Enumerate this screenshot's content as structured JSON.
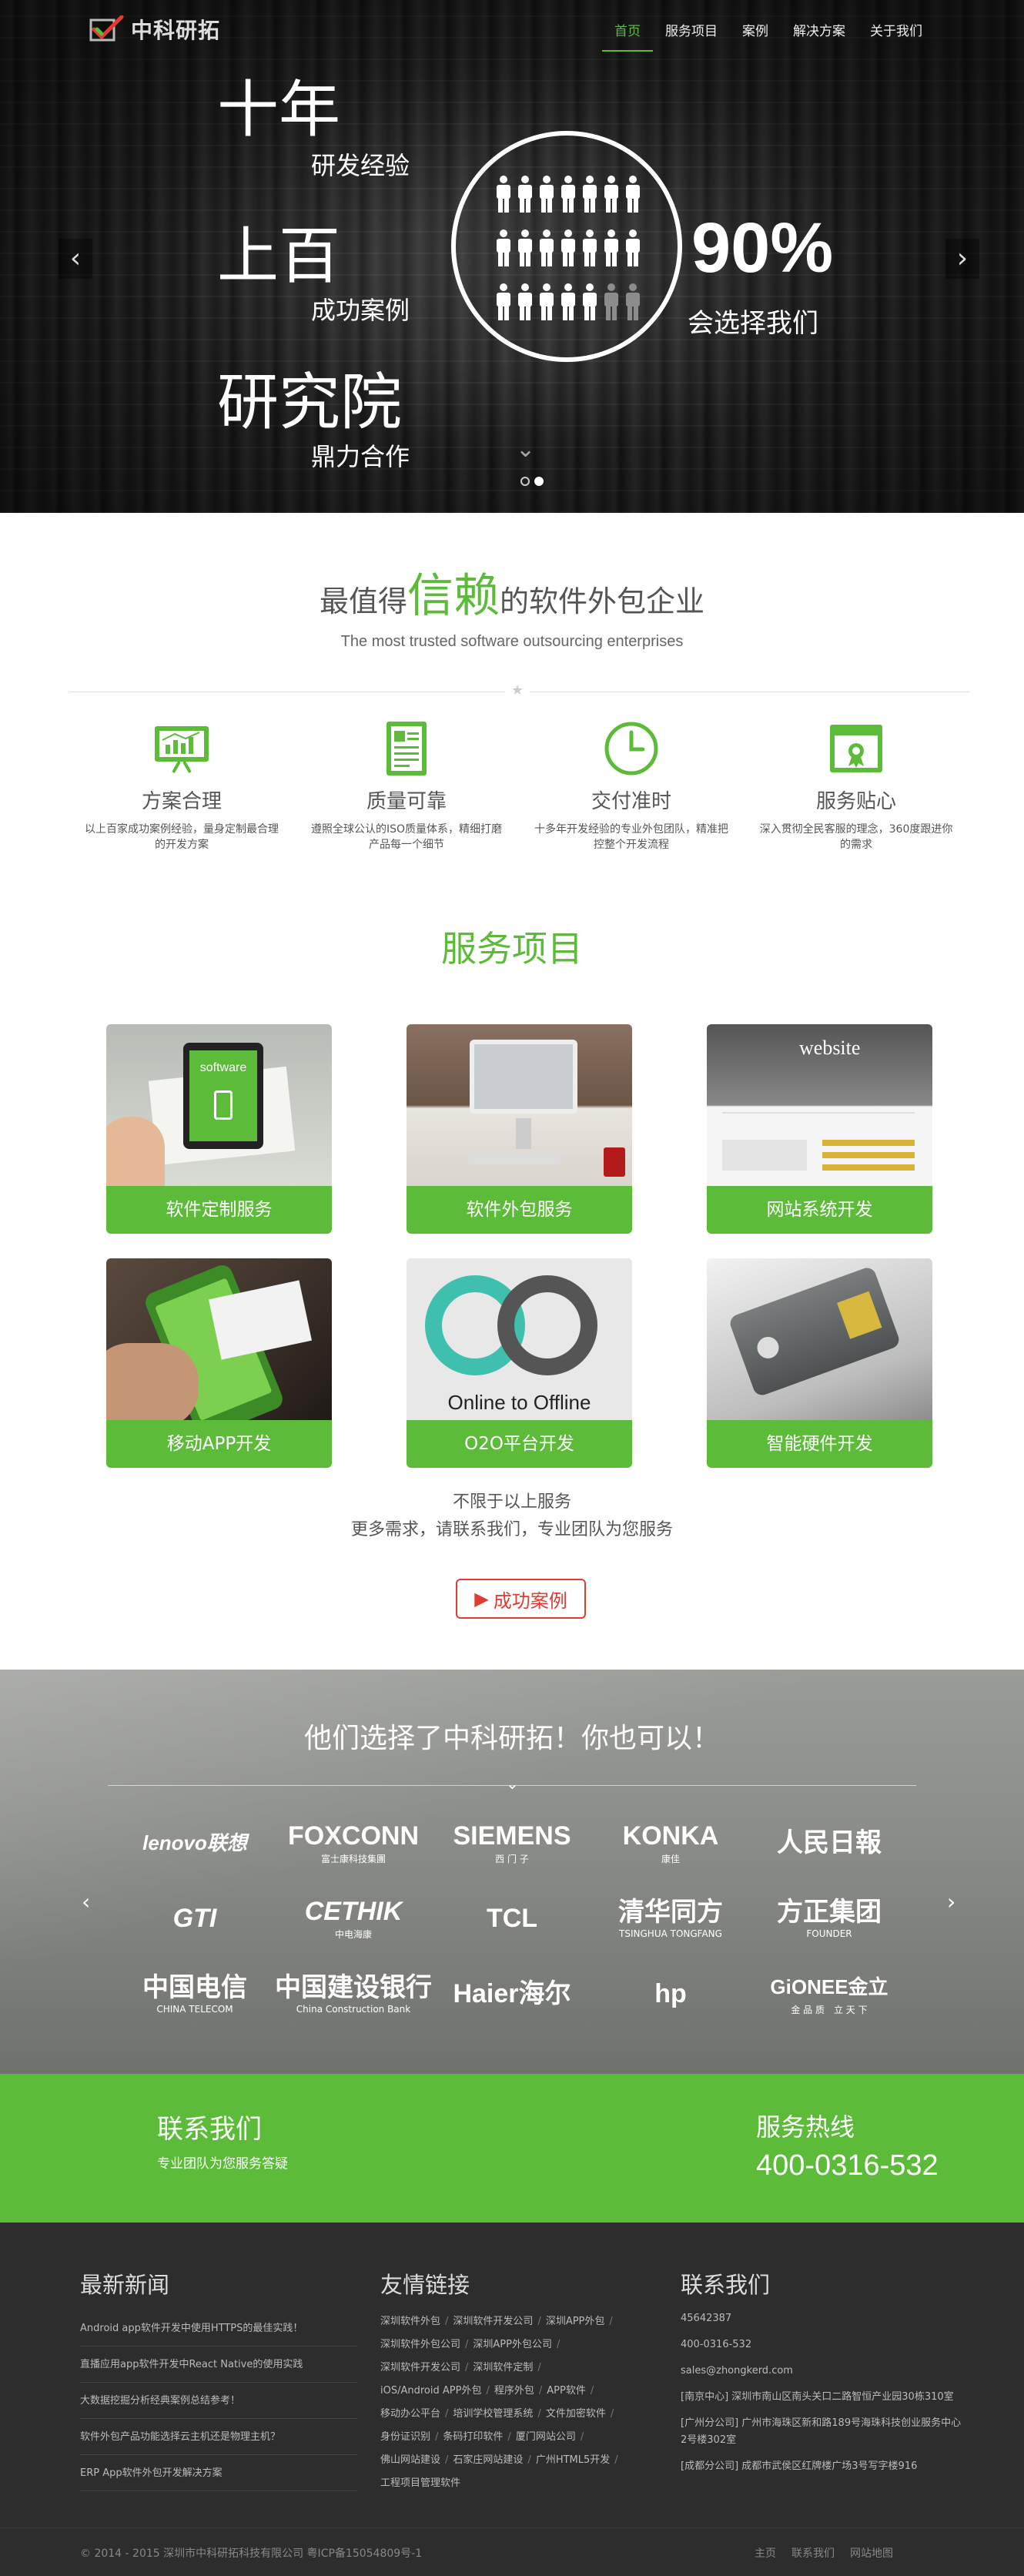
{
  "nav": {
    "logo_text": "中科研拓",
    "items": [
      {
        "label": "首页",
        "active": true
      },
      {
        "label": "服务项目",
        "active": false
      },
      {
        "label": "案例",
        "active": false
      },
      {
        "label": "解决方案",
        "active": false
      },
      {
        "label": "关于我们",
        "active": false
      }
    ]
  },
  "hero": {
    "line1_big": "十年",
    "line1_small": "研发经验",
    "line2_big": "上百",
    "line2_small": "成功案例",
    "line3_big": "研究院",
    "line3_small": "鼎力合作",
    "percent": "90%",
    "percent_caption": "会选择我们",
    "people_total": 21,
    "people_highlighted": 19,
    "prev_icon": "chevron-left-icon",
    "next_icon": "chevron-right-icon",
    "slides": 2,
    "active_slide": 2
  },
  "trust": {
    "title_pre": "最值得",
    "title_highlight": "信赖",
    "title_post": "的软件外包企业",
    "subtitle": "The most trusted software outsourcing enterprises"
  },
  "features": [
    {
      "icon": "chart-board-icon",
      "title": "方案合理",
      "desc": "以上百家成功案例经验，量身定制最合理的开发方案"
    },
    {
      "icon": "document-icon",
      "title": "质量可靠",
      "desc": "遵照全球公认的ISO质量体系，精细打磨产品每一个细节"
    },
    {
      "icon": "clock-icon",
      "title": "交付准时",
      "desc": "十多年开发经验的专业外包团队，精准把控整个开发流程"
    },
    {
      "icon": "certificate-icon",
      "title": "服务贴心",
      "desc": "深入贯彻全民客服的理念，360度跟进你的需求"
    }
  ],
  "services": {
    "title": "服务项目",
    "items": [
      {
        "label": "软件定制服务",
        "image_text": "software"
      },
      {
        "label": "软件外包服务",
        "image_text": ""
      },
      {
        "label": "网站系统开发",
        "image_text": "website"
      },
      {
        "label": "移动APP开发",
        "image_text": ""
      },
      {
        "label": "O2O平台开发",
        "image_text": "Online to Offline"
      },
      {
        "label": "智能硬件开发",
        "image_text": ""
      }
    ],
    "note_line1": "不限于以上服务",
    "note_line2": "更多需求，请联系我们，专业团队为您服务",
    "case_button": "成功案例"
  },
  "clients": {
    "title": "他们选择了中科研拓！你也可以！",
    "logos": [
      {
        "name": "lenovo联想",
        "sub": ""
      },
      {
        "name": "FOXCONN",
        "sub": "富士康科技集團"
      },
      {
        "name": "SIEMENS",
        "sub": "西 门 子"
      },
      {
        "name": "KONKA",
        "sub": "康佳"
      },
      {
        "name": "人民日報",
        "sub": ""
      },
      {
        "name": "GTI",
        "sub": ""
      },
      {
        "name": "CETHIK",
        "sub": "中电海康"
      },
      {
        "name": "TCL",
        "sub": ""
      },
      {
        "name": "清华同方",
        "sub": "TSINGHUA TONGFANG"
      },
      {
        "name": "方正集团",
        "sub": "FOUNDER"
      },
      {
        "name": "中国电信",
        "sub": "CHINA TELECOM"
      },
      {
        "name": "中国建设银行",
        "sub": "China Construction Bank"
      },
      {
        "name": "Haier海尔",
        "sub": ""
      },
      {
        "name": "hp",
        "sub": ""
      },
      {
        "name": "GiONEE金立",
        "sub": "金 品 质　立 天 下"
      }
    ]
  },
  "contact": {
    "title": "联系我们",
    "subtitle": "专业团队为您服务答疑",
    "hotline_title": "服务热线",
    "hotline": "400-0316-532"
  },
  "footer": {
    "news_title": "最新新闻",
    "news": [
      "Android app软件开发中使用HTTPS的最佳实践！",
      "直播应用app软件开发中React Native的使用实践",
      "大数据挖掘分析经典案例总结参考！",
      "软件外包产品功能选择云主机还是物理主机？",
      "ERP App软件外包开发解决方案"
    ],
    "links_title": "友情链接",
    "links": [
      "深圳软件外包",
      "深圳软件开发公司",
      "深圳APP外包",
      "深圳软件外包公司",
      "深圳APP外包公司",
      "深圳软件开发公司",
      "深圳软件定制",
      "iOS/Android APP外包",
      "程序外包",
      "APP软件",
      "移动办公平台",
      "培训学校管理系统",
      "文件加密软件",
      "身份证识别",
      "条码打印软件",
      "厦门网站公司",
      "佛山网站建设",
      "石家庄网站建设",
      "广州HTML5开发",
      "工程项目管理软件"
    ],
    "contact_title": "联系我们",
    "contacts": [
      "45642387",
      "400-0316-532",
      "sales@zhongkerd.com",
      "[南京中心] 深圳市南山区南头关口二路智恒产业园30栋310室",
      "[广州分公司] 广州市海珠区新和路189号海珠科技创业服务中心2号楼302室",
      "[成都分公司] 成都市武侯区红牌楼广场3号写字楼916"
    ],
    "copyright": "© 2014 - 2015 深圳市中科研拓科技有限公司 粤ICP备15054809号-1",
    "bottom_links": [
      "主页",
      "联系我们",
      "网站地图"
    ]
  }
}
